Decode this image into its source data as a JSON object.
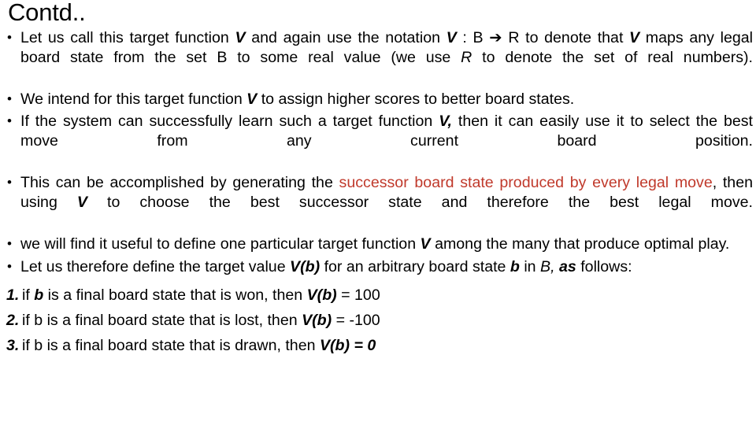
{
  "slide": {
    "title": "Contd..",
    "accent_red": "#C0392B",
    "text_color": "#000000",
    "background": "#ffffff"
  },
  "bullets": [
    {
      "id": "bullet-target-function-notation",
      "marker": "•",
      "text": "Let us call this target function V and again use the notation V : B ➔ R to denote that V maps any legal board state from the set B to some real value (we use R to denote the set of real numbers)."
    },
    {
      "id": "bullet-higher-scores",
      "marker": "•",
      "text": "We intend for this target function V to assign higher scores to better board states."
    },
    {
      "id": "bullet-select-best-move",
      "marker": "•",
      "text": "If the system can successfully learn such a target function V, then it can easily use it to select the best move from any current board position."
    },
    {
      "id": "bullet-successor-board-state",
      "marker": "•",
      "text": "This can be accomplished by generating the successor board state produced by every legal move, then using V to choose the best successor state and therefore  the best legal move.",
      "highlight": "successor board state produced by every legal move"
    },
    {
      "id": "bullet-optimal-play",
      "marker": "•",
      "text": "we will find it useful to define one particular target function V among the many that produce optimal play."
    },
    {
      "id": "bullet-define-target-value",
      "marker": "•",
      "text": "Let us therefore define the target value V(b) for an arbitrary board state b in B, as follows:"
    }
  ],
  "numbered": [
    {
      "id": "numbered-item-won",
      "marker": "1.",
      "text": "if b is a final board state that is won, then V(b) = 100",
      "value": "100"
    },
    {
      "id": "numbered-item-lost",
      "marker": "2.",
      "text": "if b is a final board state that is lost, then V(b) = -100",
      "value": "-100"
    },
    {
      "id": "numbered-item-drawn",
      "marker": "3.",
      "text": "if b is a final board state that is drawn, then V(b) = 0",
      "value": "0"
    }
  ],
  "fragments": {
    "b1_a": "Let us call this target function ",
    "b1_V1": "V",
    "b1_b": " and again use the notation ",
    "b1_V2": "V",
    "b1_c": " : B ",
    "b1_arrow": "➔",
    "b1_d": " R to denote that ",
    "b1_V3": "V",
    "b1_e": " maps any legal board state from the set B to some real value (we use ",
    "b1_R": "R",
    "b1_f": " to denote the set of real numbers).",
    "b2_a": "We intend for this target function ",
    "b2_V": "V",
    "b2_b": " to assign higher scores to better board states.",
    "b3_a": "If the system can successfully learn such a target function ",
    "b3_V": "V,",
    "b3_b": " then it can easily use it to select the best move from any current board position.",
    "b4_a": "This can be accomplished by generating the ",
    "b4_red": "successor board state produced by every legal move",
    "b4_b": ", then using ",
    "b4_V": "V",
    "b4_c": " to choose the best successor state and therefore  the best legal move.",
    "b5_a": "we will find it useful to define one particular target function ",
    "b5_V": "V",
    "b5_b": " among the many that produce optimal play.",
    "b6_a": "Let us therefore define the target value ",
    "b6_Vb": "V(b)",
    "b6_b": " for an arbitrary board state ",
    "b6_bchar": "b",
    "b6_c": " in ",
    "b6_B": "B,",
    "b6_as": "as",
    "b6_d": " follows:",
    "n1_marker": "1.",
    "n1_a": "if ",
    "n1_b": "b",
    "n1_c": " is a final board state that is won, then ",
    "n1_Vb": "V(b)",
    "n1_eq": " = 100",
    "n2_marker": "2.",
    "n2_a": "if b is a final board state that is lost, then ",
    "n2_Vb": "V(b)",
    "n2_eq": " = -100",
    "n3_marker": "3.",
    "n3_a": "if b is a final board state that is drawn, then ",
    "n3_Vb": "V(b) = 0"
  }
}
